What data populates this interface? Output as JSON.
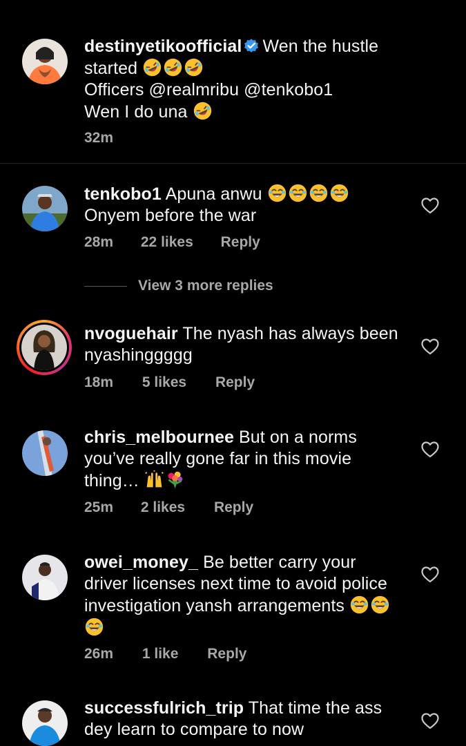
{
  "caption": {
    "username": "destinyetikoofficial",
    "verified": true,
    "line1_text": "Wen the hustle",
    "line2_text": "started",
    "line2_emoji": "rolling-on-floor-laughing x3",
    "line3_text": "Officers @realmribu @tenkobo1",
    "line4_text": "Wen I do una",
    "line4_emoji": "rolling-on-floor-laughing",
    "time": "32m"
  },
  "comments": [
    {
      "username": "tenkobo1",
      "line1": "Apuna anwu",
      "line1_emoji": "grinning-squinting-tears x4",
      "line2": "Onyem before the war",
      "time": "28m",
      "likes": "22 likes",
      "reply": "Reply",
      "view_more": "View 3 more replies"
    },
    {
      "username": "nvoguehair",
      "line1": "The nyash has always been",
      "line2": "nyashinggggg",
      "time": "18m",
      "likes": "5 likes",
      "reply": "Reply",
      "has_story": true
    },
    {
      "username": "chris_melbournee",
      "line1": "But on a norms",
      "line2": "you’ve really gone far in this movie",
      "line3": "thing…",
      "line3_emoji": "raising-hands, bouquet",
      "time": "25m",
      "likes": "2 likes",
      "reply": "Reply"
    },
    {
      "username": "owei_money_",
      "line1": "Be better carry your",
      "line2": "driver licenses next time to avoid police",
      "line3": "investigation yansh arrangements",
      "line3_emoji": "grinning-squinting-tears x3",
      "time": "26m",
      "likes": "1 like",
      "reply": "Reply"
    },
    {
      "username": "successfulrich_trip",
      "line1": "That time the ass",
      "line2": "dey learn to compare to now"
    }
  ],
  "colors": {
    "background": "#000000",
    "text": "#f5f5f5",
    "meta": "#a8a8a8",
    "verified": "#3897f0"
  }
}
